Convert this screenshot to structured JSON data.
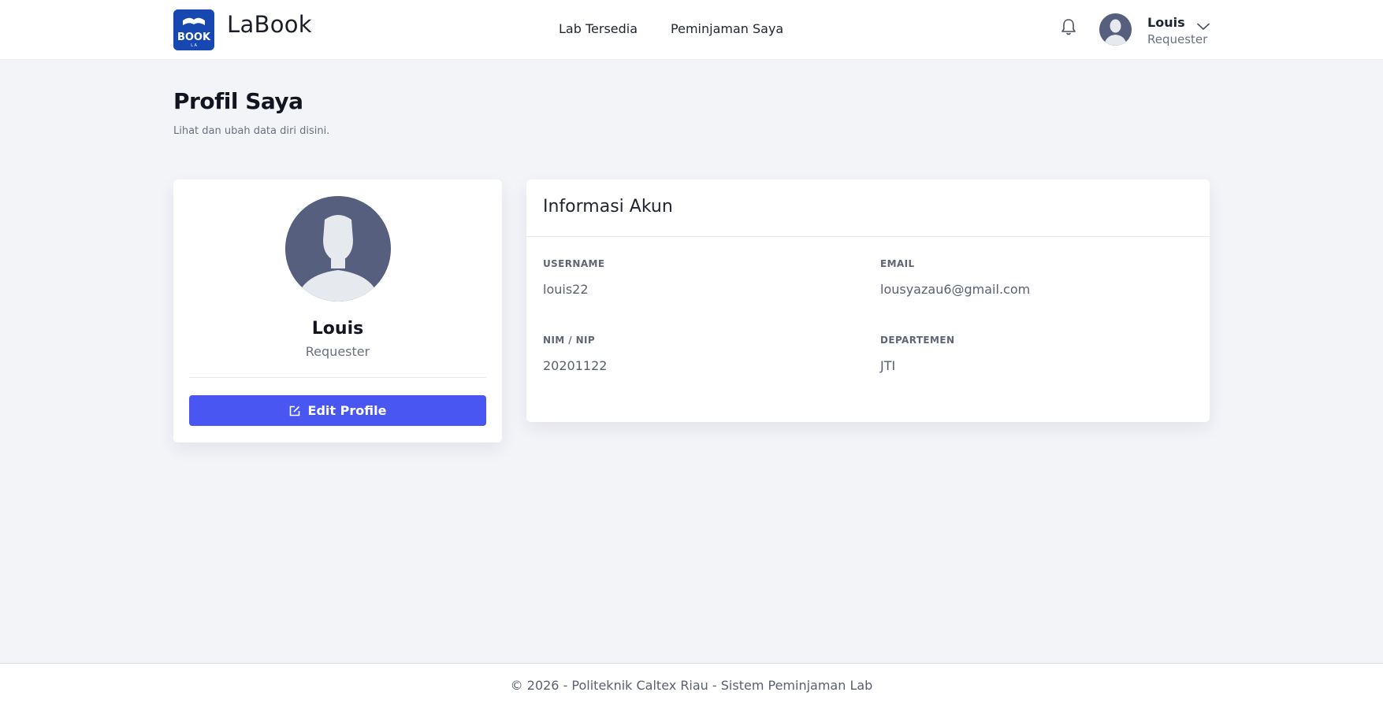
{
  "header": {
    "brand_name": "LaBook",
    "logo_text": "BOOK",
    "nav": [
      {
        "label": "Lab Tersedia"
      },
      {
        "label": "Peminjaman Saya"
      }
    ],
    "user": {
      "name": "Louis",
      "role": "Requester"
    },
    "icons": {
      "notification": "bell-icon",
      "menu": "chevron-down-icon"
    }
  },
  "page": {
    "title": "Profil Saya",
    "subtitle": "Lihat dan ubah data diri disini."
  },
  "profile_card": {
    "name": "Louis",
    "role": "Requester",
    "edit_button_label": "Edit Profile"
  },
  "account_info": {
    "title": "Informasi Akun",
    "fields": [
      {
        "label": "USERNAME",
        "value": "louis22"
      },
      {
        "label": "EMAIL",
        "value": "lousyazau6@gmail.com"
      },
      {
        "label": "NIM / NIP",
        "value": "20201122"
      },
      {
        "label": "DEPARTEMEN",
        "value": "JTI"
      }
    ]
  },
  "footer": {
    "text": "© 2026 - Politeknik Caltex Riau - Sistem Peminjaman Lab"
  },
  "colors": {
    "primary": "#4a56f2",
    "logo_bg": "#1747b0",
    "avatar_bg": "#56607e",
    "page_bg": "#f3f4f8"
  }
}
